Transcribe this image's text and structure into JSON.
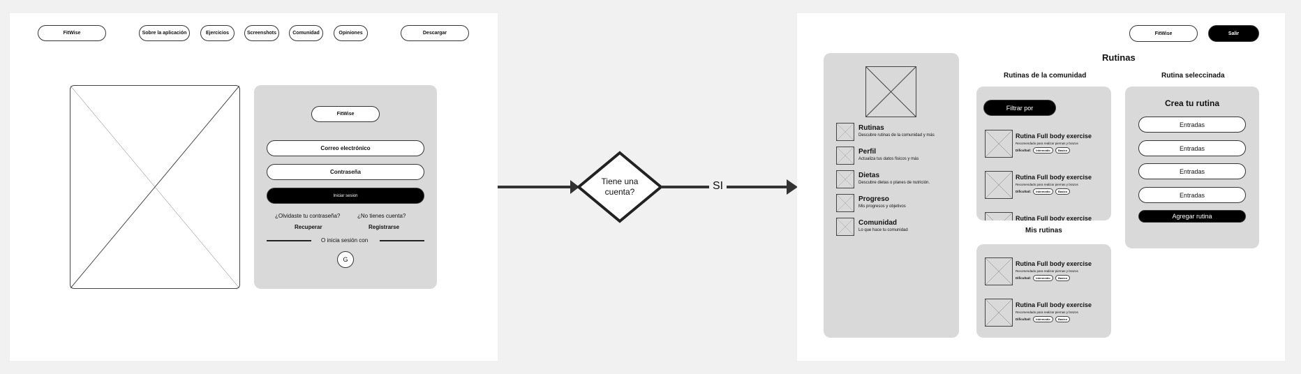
{
  "login_screen": {
    "nav": {
      "logo": "FitWise",
      "links": [
        "Sobre la aplicación",
        "Ejercicios",
        "Screenshots",
        "Comunidad",
        "Opiniones"
      ],
      "download": "Descargar"
    },
    "card": {
      "logo": "FitWise",
      "email_label": "Correo electrónico",
      "password_label": "Contraseña",
      "login_button": "Iniciar sesion",
      "forgot_question": "¿Olvidaste tu contraseña?",
      "recover": "Recuperar",
      "no_account_question": "¿No tienes cuenta?",
      "register": "Registrarse",
      "divider_text": "O inicia sesión con",
      "google": "G"
    }
  },
  "flow": {
    "decision": "Tiene una cuenta?",
    "yes_label": "SI"
  },
  "routines_screen": {
    "header": {
      "logo": "FitWise",
      "logout": "Salir"
    },
    "page_title": "Rutinas",
    "sidebar": [
      {
        "title": "Rutinas",
        "desc": "Descubre rutinas de la comunidad y más"
      },
      {
        "title": "Perfil",
        "desc": "Actualiza tus datos fisicos y más"
      },
      {
        "title": "Dietas",
        "desc": "Descubre dietas o planes de nutrición."
      },
      {
        "title": "Progreso",
        "desc": "Mis progresos y objetivos"
      },
      {
        "title": "Comunidad",
        "desc": "Lo que hace tu comunidad"
      }
    ],
    "community": {
      "heading": "Rutinas de la comunidad",
      "filter": "Filtrar por",
      "items": [
        {
          "title": "Rutina Full body exercise",
          "desc": "Recomendado para realizar piernas y brazos",
          "difficulty_label": "Dificultad:",
          "tags": [
            "Intermedio",
            "Basico"
          ]
        },
        {
          "title": "Rutina Full body exercise",
          "desc": "Recomendado para realizar piernas y brazos",
          "difficulty_label": "Dificultad:",
          "tags": [
            "Intermedio",
            "Basico"
          ]
        },
        {
          "title": "Rutina Full body exercise"
        }
      ]
    },
    "mine": {
      "heading": "Mis rutinas",
      "items": [
        {
          "title": "Rutina Full body exercise",
          "desc": "Recomendado para realizar piernas y brazos",
          "difficulty_label": "Dificultad:",
          "tags": [
            "Intermedio",
            "Basico"
          ]
        },
        {
          "title": "Rutina Full body exercise",
          "desc": "Recomendado para realizar piernas y brazos",
          "difficulty_label": "Dificultad:",
          "tags": [
            "Intermedio",
            "Basico"
          ]
        }
      ]
    },
    "selected": {
      "heading": "Rutina seleccinada",
      "title": "Crea tu rutina",
      "inputs": [
        "Entradas",
        "Entradas",
        "Entradas",
        "Entradas"
      ],
      "add_button": "Agregar rutina"
    }
  }
}
